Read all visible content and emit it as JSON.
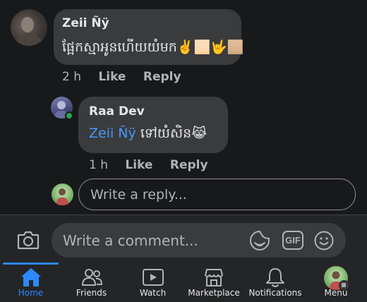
{
  "comment": {
    "author": "Zeii Ñÿ",
    "text": "ផ្អែកស្មាអូនហើយយំមក✌🏻🤟🏼",
    "time": "2 h",
    "like": "Like",
    "reply": "Reply"
  },
  "reply_comment": {
    "author": "Raa Dev",
    "mention": "Zeii Ñÿ",
    "text": "ទៅយំសិន😹",
    "time": "1 h",
    "like": "Like",
    "reply": "Reply"
  },
  "reply_input": {
    "placeholder": "Write a reply..."
  },
  "composer": {
    "placeholder": "Write a comment...",
    "gif_label": "GIF"
  },
  "nav": {
    "items": [
      {
        "label": "Home"
      },
      {
        "label": "Friends"
      },
      {
        "label": "Watch"
      },
      {
        "label": "Marketplace"
      },
      {
        "label": "Notifications"
      },
      {
        "label": "Menu"
      }
    ]
  },
  "colors": {
    "accent": "#2d88ff",
    "mention": "#4599ff",
    "background": "#18191a",
    "bubble": "#3a3b3c",
    "online": "#31a24c"
  }
}
